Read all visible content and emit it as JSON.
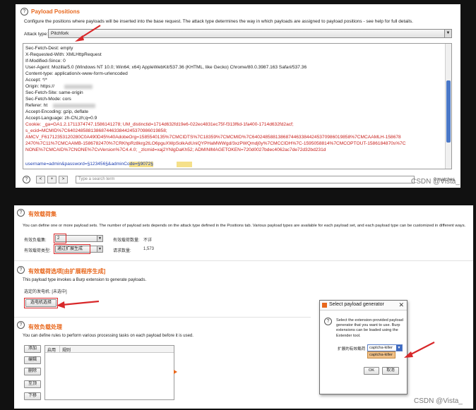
{
  "top_panel": {
    "title": "Payload Positions",
    "description": "Configure the positions where payloads will be inserted into the base request. The attack type determines the way in which payloads are assigned to payload positions - see help for full details.",
    "attack_type_label": "Attack type:",
    "attack_type_value": "Pitchfork",
    "request_lines": [
      "Sec-Fetch-Dest: empty",
      "X-Requested-With: XMLHttpRequest",
      "If-Modified-Since: 0",
      "User-Agent: Mozilla/5.0 (Windows NT 10.0; Win64; x64) AppleWebKit/537.36 (KHTML, like Gecko) Chrome/80.0.3987.163 Safari/537.36",
      "Content-type: application/x-www-form-urlencoded",
      "Accept: */*",
      "Origin: https://",
      "Sec-Fetch-Site: same-origin",
      "Sec-Fetch-Mode: cors",
      "Referer: ht",
      "Accept-Encoding: gzip, deflate",
      "Accept-Language: zh-CN,zh;q=0.9"
    ],
    "cookie_lines": [
      "Cookie: _ga=GA1.2.1711374747.1586141278; UM_distinctid=1714d632fd19e6-022ec4831ec75f-f313f6d-1fa400-1714d632fd2acf;",
      "s_ecid=MCMID%7C64024858813868744633844245370986019858;",
      "AMCV_F61712353120280C0A490D45%40AdobeOrg=1585540135%7CMCIDTS%7C18359%7CMCMID%7C64024858813868744633844245370986019858%7CMCAAMLH-158678",
      "2470%7C11%7CMCAAMB-1586782470%7CRKhpRz8krg2tLO6pguXWpSolkAdUniQYPHaMWWgd/3xzPWQmdj0y%7CMCCIDH%7C-1595058814%7CMCOPTOUT-1586184870s%7C",
      "NONE%7CMCAID%7CNONE%7CvVersion%7C4.4.0; _zlcmid=xaj2YNlgDaKh52; ADMINIMAGETOKEN=720d0027bdec4062ac7de72d32bd231d"
    ],
    "body_line": "username=admin&password=§123456§&adminCode=§9072§",
    "toolbar": {
      "help": "?",
      "prev": "<",
      "add": "+",
      "next": ">",
      "search_placeholder": "Type a search term",
      "matches": "0 matches"
    }
  },
  "bottom_panel": {
    "payload_sets": {
      "title": "有效载荷集",
      "description": "You can define one or more payload sets. The number of payload sets depends on the attack type defined in the Positions tab. Various payload types are available for each payload set, and each payload type can be customized in different ways.",
      "set_label": "有效负载集:",
      "set_value": "2",
      "type_label": "有效载荷类型:",
      "type_value": "通过扩展生成",
      "count_label": "有效载荷数量:",
      "count_value": "不详",
      "request_label": "请求数量:",
      "request_value": "1,573"
    },
    "payload_options": {
      "title": "有效载荷选项[由扩展程序生成]",
      "description": "This payload type invokes a Burp extension to generate payloads.",
      "selected_label": "选定的发电机: [未选中]",
      "select_button": "选电机选择"
    },
    "payload_processing": {
      "title": "有效负载处理",
      "description": "You can define rules to perform various processing tasks on each payload before it is used.",
      "buttons": [
        "添加",
        "编辑",
        "删除",
        "至顶",
        "下移"
      ],
      "col_enabled": "启用",
      "col_rule": "规则"
    }
  },
  "dialog": {
    "title": "Select payload generator",
    "close": "✕",
    "description": "Select the extension-provided payload generator that you want to use. Burp extensions can be loaded using the Extender tool.",
    "field_label": "扩展的有效载荷",
    "select_value": "captcha-killer",
    "option": "captcha-killer",
    "ok": "OK",
    "cancel": "取消"
  },
  "watermarks": {
    "top": "CSDN @Vista_",
    "bottom": "CSDN @Vista_"
  },
  "colors": {
    "section_title": "#e8671c",
    "annotation_red": "#d8282a",
    "cookie_red": "#c8201c",
    "body_blue": "#1e3fb0",
    "scroll_blue": "#4a78c8"
  }
}
